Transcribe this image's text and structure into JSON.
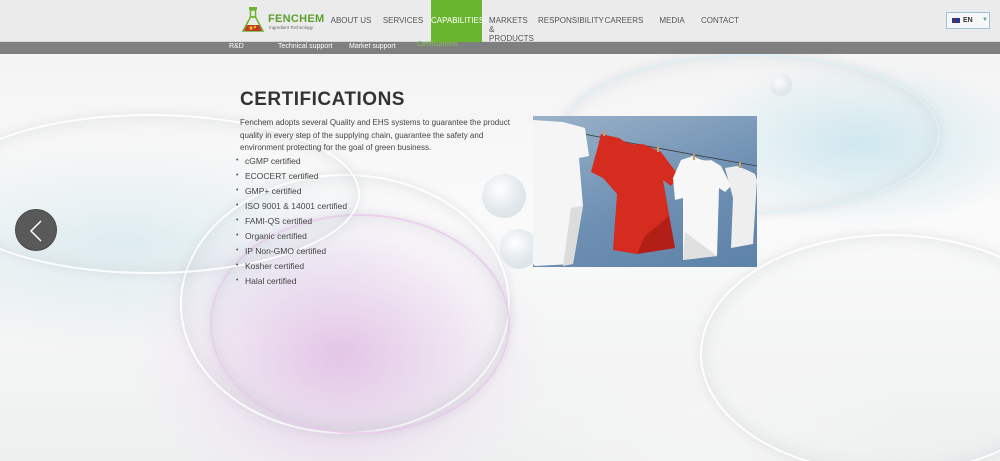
{
  "brand": {
    "name": "FENCHEM",
    "tagline": "Ingredient Technology"
  },
  "nav": {
    "items": [
      {
        "label": "ABOUT US"
      },
      {
        "label": "SERVICES"
      },
      {
        "label": "CAPABILITIES",
        "active": true
      },
      {
        "label": "MARKETS &",
        "label2": "PRODUCTS"
      },
      {
        "label": "RESPONSIBILITY"
      },
      {
        "label": "CAREERS"
      },
      {
        "label": "MEDIA"
      },
      {
        "label": "CONTACT"
      }
    ],
    "language": "EN"
  },
  "subnav": {
    "items": [
      {
        "label": "R&D"
      },
      {
        "label": "Technical support"
      },
      {
        "label": "Market support"
      },
      {
        "label": "Certifications",
        "active": true
      }
    ]
  },
  "content": {
    "title": "CERTIFICATIONS",
    "description": "Fenchem adopts several Quality and EHS systems to guarantee the product quality in every step of the supplying chain, guarantee the safety and environment protecting for the goal of green business.",
    "certifications": [
      "cGMP certified",
      "ECOCERT certified",
      "GMP+ certified",
      "ISO 9001 & 14001 certified",
      "FAMI-QS certified",
      "Organic certified",
      "IP Non-GMO certified",
      "Kosher certified",
      "Halal certified"
    ]
  },
  "colors": {
    "accent": "#6ab52f",
    "subnav_bg": "#7f7f7f",
    "header_bg": "#ebebeb"
  },
  "icons": {
    "previous": "chevron-left-icon",
    "language_flag": "uk-flag-icon",
    "dropdown": "caret-down-icon"
  }
}
